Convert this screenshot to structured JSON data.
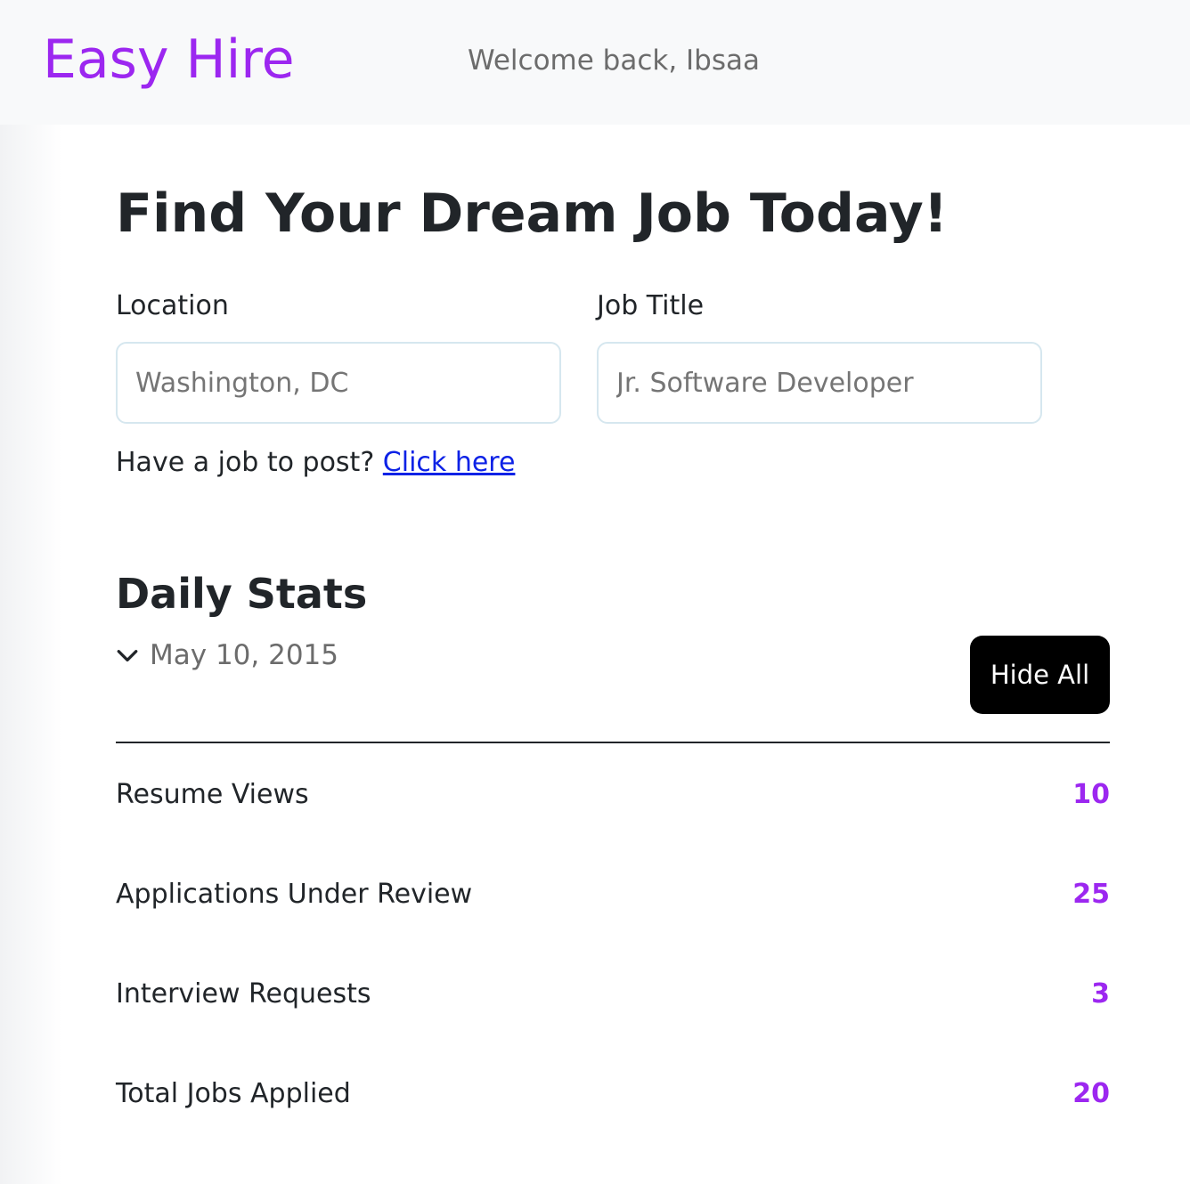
{
  "header": {
    "brand": "Easy Hire",
    "welcome": "Welcome back, Ibsaa"
  },
  "hero": {
    "title": "Find Your Dream Job Today!"
  },
  "search": {
    "location_label": "Location",
    "location_placeholder": "Washington, DC",
    "job_title_label": "Job Title",
    "job_title_placeholder": "Jr. Software Developer"
  },
  "post": {
    "prompt": "Have a job to post?",
    "link_label": "Click here"
  },
  "stats": {
    "title": "Daily Stats",
    "date": "May 10, 2015",
    "hide_all_label": "Hide All",
    "items": [
      {
        "label": "Resume Views",
        "value": "10"
      },
      {
        "label": "Applications Under Review",
        "value": "25"
      },
      {
        "label": "Interview Requests",
        "value": "3"
      },
      {
        "label": "Total Jobs Applied",
        "value": "20"
      }
    ]
  },
  "colors": {
    "brand": "#9c27f0",
    "link": "#0d22e6",
    "button_bg": "#000000"
  }
}
